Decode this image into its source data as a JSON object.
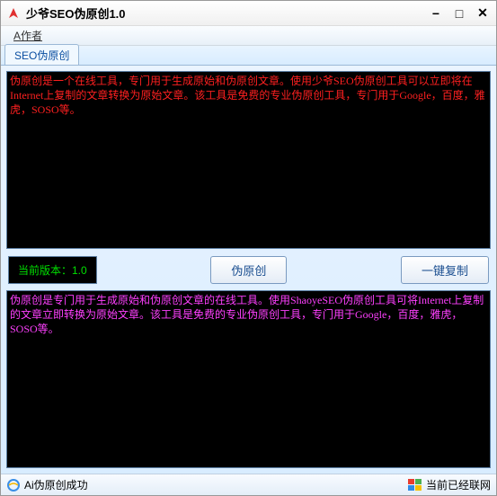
{
  "window": {
    "title": "少爷SEO伪原创1.0"
  },
  "menu": {
    "author": "A作者"
  },
  "tabs": {
    "main": "SEO伪原创"
  },
  "input_text": "伪原创是一个在线工具，专门用于生成原始和伪原创文章。使用少爷SEO伪原创工具可以立即将在Internet上复制的文章转换为原始文章。该工具是免费的专业伪原创工具，专门用于Google，百度，雅虎，SOSO等。",
  "version": {
    "label": "当前版本：1.0"
  },
  "buttons": {
    "rewrite": "伪原创",
    "copy": "一键复制"
  },
  "output_text": "伪原创是专门用于生成原始和伪原创文章的在线工具。使用ShaoyeSEO伪原创工具可将Internet上复制的文章立即转换为原始文章。该工具是免费的专业伪原创工具，专门用于Google，百度，雅虎，SOSO等。",
  "status": {
    "left": "Ai伪原创成功",
    "right": "当前已经联网"
  }
}
